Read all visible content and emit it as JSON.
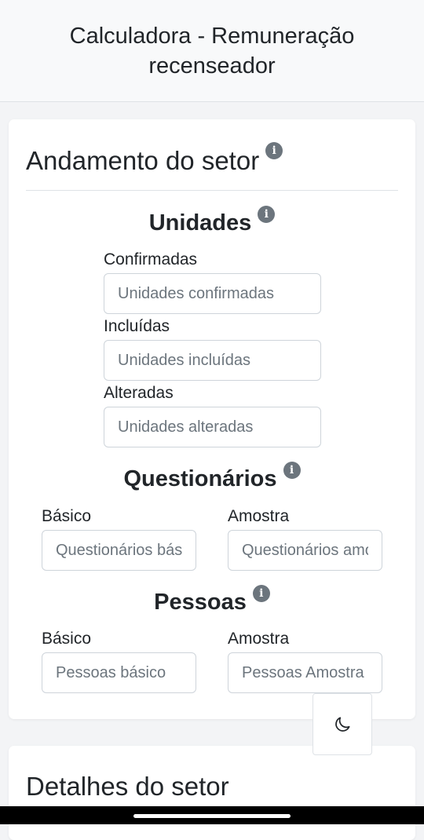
{
  "header": {
    "title": "Calculadora - Remuneração recenseador"
  },
  "sector_progress": {
    "title": "Andamento do setor",
    "info_glyph": "i",
    "units": {
      "title": "Unidades",
      "confirmed": {
        "label": "Confirmadas",
        "placeholder": "Unidades confirmadas",
        "value": ""
      },
      "included": {
        "label": "Incluídas",
        "placeholder": "Unidades incluídas",
        "value": ""
      },
      "altered": {
        "label": "Alteradas",
        "placeholder": "Unidades alteradas",
        "value": ""
      }
    },
    "questionnaires": {
      "title": "Questionários",
      "basic": {
        "label": "Básico",
        "placeholder": "Questionários básico",
        "value": ""
      },
      "sample": {
        "label": "Amostra",
        "placeholder": "Questionários amostra",
        "value": ""
      }
    },
    "people": {
      "title": "Pessoas",
      "basic": {
        "label": "Básico",
        "placeholder": "Pessoas básico",
        "value": ""
      },
      "sample": {
        "label": "Amostra",
        "placeholder": "Pessoas Amostra",
        "value": ""
      }
    }
  },
  "sector_details": {
    "title": "Detalhes do setor"
  },
  "theme_toggle": {
    "icon": "moon-icon"
  },
  "colors": {
    "info_icon": "#6c757d",
    "placeholder": "#6c757d",
    "border": "#ced4da"
  }
}
